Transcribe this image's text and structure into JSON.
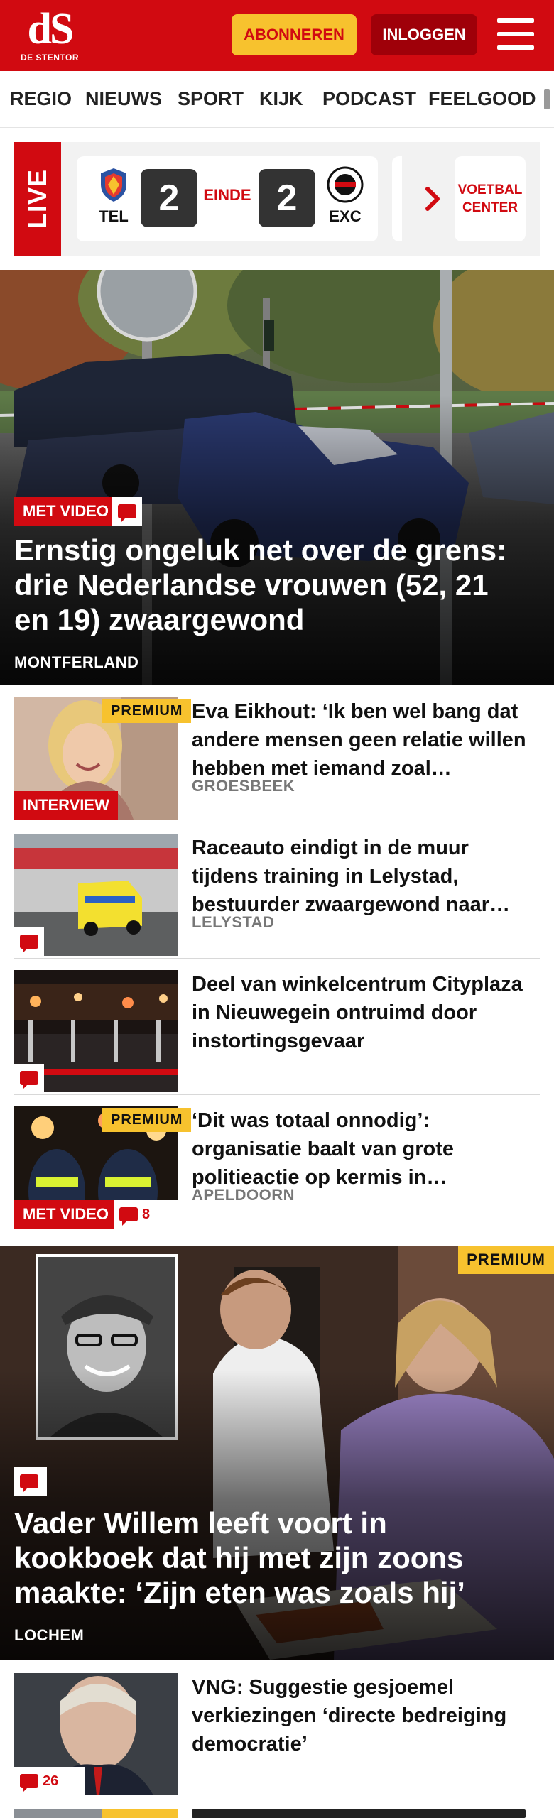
{
  "header": {
    "logo_mark": "dS",
    "logo_text": "DE STENTOR",
    "subscribe_label": "ABONNEREN",
    "login_label": "INLOGGEN",
    "menu_icon": "hamburger-menu-icon"
  },
  "nav": {
    "items": [
      "REGIO",
      "NIEUWS",
      "SPORT",
      "KIJK",
      "PODCAST",
      "FEELGOOD"
    ]
  },
  "live": {
    "label": "LIVE",
    "home_team": "TEL",
    "home_score": "2",
    "status": "EINDE",
    "away_score": "2",
    "away_team": "EXC",
    "arrow_icon": "chevron-right-icon",
    "football_center_line1": "VOETBAL",
    "football_center_line2": "CENTER"
  },
  "hero1": {
    "video_label": "MET VIDEO",
    "title": "Ernstig ongeluk net over de grens: drie Nederlandse vrouwen (52, 21 en 19) zwaargewond",
    "place": "MONTFERLAND"
  },
  "list1": [
    {
      "title": "Eva Eikhout: ‘Ik ben wel bang dat andere mensen geen relatie willen hebben met iemand zoal…",
      "place": "GROESBEEK",
      "premium": "PREMIUM",
      "label": "INTERVIEW"
    },
    {
      "title": "Raceauto eindigt in de muur tijdens training in Lelystad, bestuurder zwaargewond naar…",
      "place": "LELYSTAD"
    },
    {
      "title": "Deel van winkelcentrum Cityplaza in Nieuwegein ontruimd door instortingsgevaar",
      "place": ""
    },
    {
      "title": "‘Dit was totaal onnodig’: organisatie baalt van grote politieactie op kermis in…",
      "place": "APELDOORN",
      "premium": "PREMIUM",
      "label": "MET VIDEO",
      "comments": "8"
    }
  ],
  "hero2": {
    "premium": "PREMIUM",
    "title": "Vader Willem leeft voort in kookboek dat hij met zijn zoons maakte: ‘Zijn eten was zoals hij’",
    "place": "LOCHEM"
  },
  "list2": [
    {
      "title": "VNG: Suggestie gesjoemel verkiezingen ‘directe bedreiging democratie’",
      "comments": "26"
    }
  ],
  "colors": {
    "brand_red": "#d10a11",
    "dark_red": "#9f0009",
    "premium_yellow": "#f7c22e"
  }
}
